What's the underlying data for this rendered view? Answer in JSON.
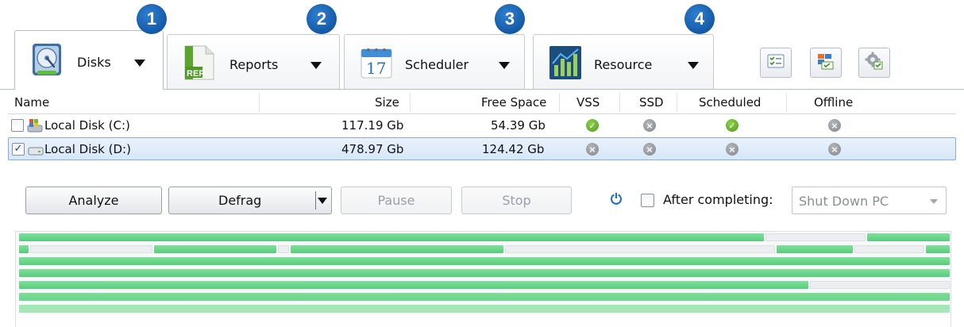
{
  "tabs": [
    {
      "label": "Disks",
      "badge": "1",
      "icon": "disk-icon"
    },
    {
      "label": "Reports",
      "badge": "2",
      "icon": "report-icon"
    },
    {
      "label": "Scheduler",
      "badge": "3",
      "icon": "calendar-icon"
    },
    {
      "label": "Resource",
      "badge": "4",
      "icon": "chart-icon"
    }
  ],
  "calendar_icon_day": "17",
  "report_icon_text": "REP",
  "toolbar_icons": [
    "checklist-icon",
    "layout-icon",
    "settings-icon"
  ],
  "table": {
    "columns": [
      "Name",
      "Size",
      "Free Space",
      "VSS",
      "SSD",
      "Scheduled",
      "Offline"
    ],
    "rows": [
      {
        "name": "Local Disk (C:)",
        "size": "117.19 Gb",
        "free": "54.39 Gb",
        "checked": false,
        "selected": false,
        "vss": "yes",
        "ssd": "no",
        "scheduled": "yes",
        "offline": "no"
      },
      {
        "name": "Local Disk (D:)",
        "size": "478.97 Gb",
        "free": "124.42 Gb",
        "checked": true,
        "selected": true,
        "vss": "no",
        "ssd": "no",
        "scheduled": "no",
        "offline": "no"
      }
    ]
  },
  "actions": {
    "analyze": "Analyze",
    "defrag": "Defrag",
    "pause": "Pause",
    "stop": "Stop",
    "after_completing": "After completing:",
    "shutdown_option": "Shut Down PC"
  },
  "colors": {
    "accent": "#135aa6",
    "used_cluster": "#58cc7c",
    "free_cluster": "#eceeef",
    "selection": "#d6e7f8",
    "status_yes": "#4f9c1e",
    "status_no": "#83878c"
  }
}
